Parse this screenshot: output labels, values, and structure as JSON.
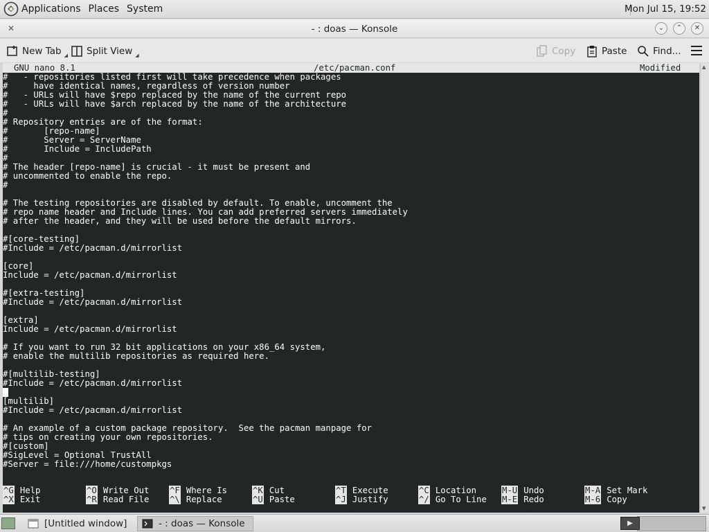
{
  "top_panel": {
    "menus": [
      "Applications",
      "Places",
      "System"
    ],
    "clock": "Mon Jul 15, 19:52"
  },
  "window": {
    "title": "- : doas — Konsole"
  },
  "toolbar": {
    "new_tab": "New Tab",
    "split_view": "Split View",
    "copy": "Copy",
    "paste": "Paste",
    "find": "Find..."
  },
  "nano": {
    "version": "GNU nano 8.1",
    "filename": "/etc/pacman.conf",
    "status": "Modified",
    "lines": [
      "#   - repositories listed first will take precedence when packages",
      "#     have identical names, regardless of version number",
      "#   - URLs will have $repo replaced by the name of the current repo",
      "#   - URLs will have $arch replaced by the name of the architecture",
      "#",
      "# Repository entries are of the format:",
      "#       [repo-name]",
      "#       Server = ServerName",
      "#       Include = IncludePath",
      "#",
      "# The header [repo-name] is crucial - it must be present and",
      "# uncommented to enable the repo.",
      "#",
      "",
      "# The testing repositories are disabled by default. To enable, uncomment the",
      "# repo name header and Include lines. You can add preferred servers immediately",
      "# after the header, and they will be used before the default mirrors.",
      "",
      "#[core-testing]",
      "#Include = /etc/pacman.d/mirrorlist",
      "",
      "[core]",
      "Include = /etc/pacman.d/mirrorlist",
      "",
      "#[extra-testing]",
      "#Include = /etc/pacman.d/mirrorlist",
      "",
      "[extra]",
      "Include = /etc/pacman.d/mirrorlist",
      "",
      "# If you want to run 32 bit applications on your x86_64 system,",
      "# enable the multilib repositories as required here.",
      "",
      "#[multilib-testing]",
      "#Include = /etc/pacman.d/mirrorlist",
      "",
      "[multilib]",
      "#Include = /etc/pacman.d/mirrorlist",
      "",
      "# An example of a custom package repository.  See the pacman manpage for",
      "# tips on creating your own repositories.",
      "#[custom]",
      "#SigLevel = Optional TrustAll",
      "#Server = file:///home/custompkgs"
    ],
    "cursor_line": 35,
    "shortcuts_row1": [
      {
        "key": "^G",
        "label": "Help"
      },
      {
        "key": "^O",
        "label": "Write Out"
      },
      {
        "key": "^F",
        "label": "Where Is"
      },
      {
        "key": "^K",
        "label": "Cut"
      },
      {
        "key": "^T",
        "label": "Execute"
      },
      {
        "key": "^C",
        "label": "Location"
      },
      {
        "key": "M-U",
        "label": "Undo"
      },
      {
        "key": "M-A",
        "label": "Set Mark"
      }
    ],
    "shortcuts_row2": [
      {
        "key": "^X",
        "label": "Exit"
      },
      {
        "key": "^R",
        "label": "Read File"
      },
      {
        "key": "^\\",
        "label": "Replace"
      },
      {
        "key": "^U",
        "label": "Paste"
      },
      {
        "key": "^J",
        "label": "Justify"
      },
      {
        "key": "^/",
        "label": "Go To Line"
      },
      {
        "key": "M-E",
        "label": "Redo"
      },
      {
        "key": "M-6",
        "label": "Copy"
      }
    ]
  },
  "taskbar": {
    "tasks": [
      "[Untitled window]",
      "- : doas — Konsole"
    ]
  }
}
